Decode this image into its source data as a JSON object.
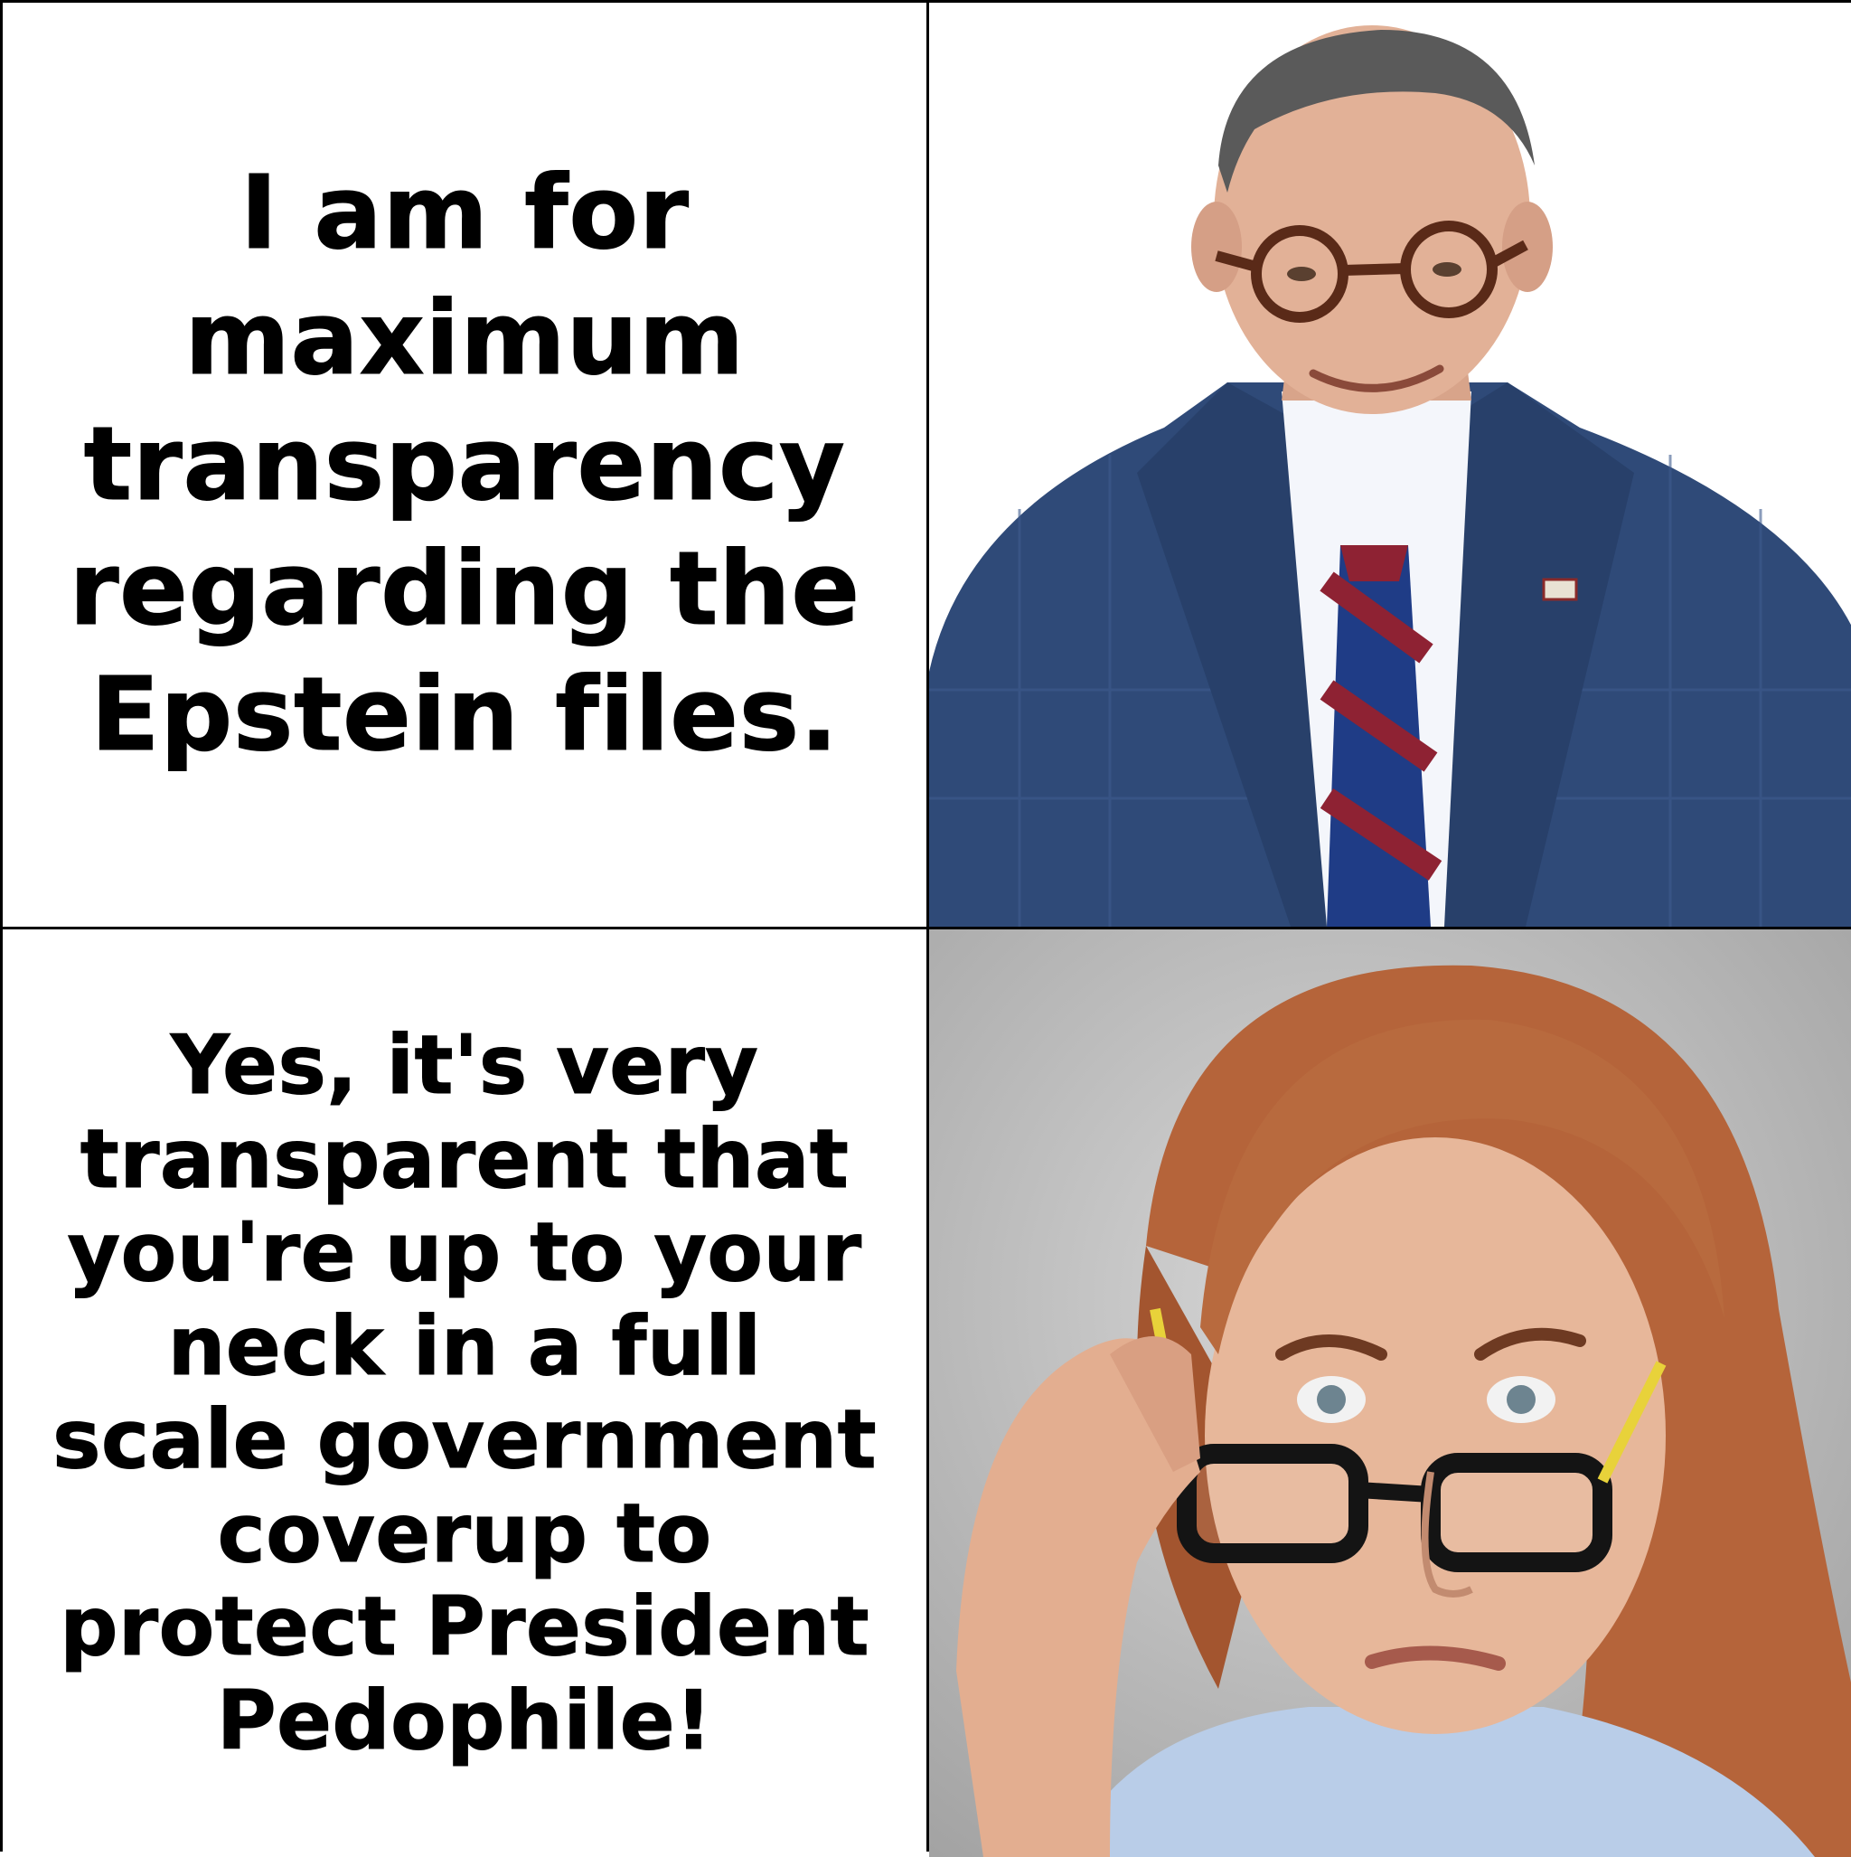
{
  "panels": {
    "top_text": "I am for maximum transparency regarding the Epstein files.",
    "bottom_text": "Yes, it's very transparent that you're up to your neck in a full scale government coverup to protect President Pedophile!"
  },
  "images": {
    "top_photo": "man-in-suit-smiling-photo",
    "bottom_photo": "woman-lowering-glasses-skeptical-photo"
  },
  "colors": {
    "background": "#ffffff",
    "text": "#000000",
    "border": "#000000",
    "suit": "#2f4a78",
    "tie_red": "#8e2233",
    "tie_blue": "#1f3c86",
    "hair_auburn": "#b5643a",
    "backdrop_gray": "#bdbdbd"
  }
}
